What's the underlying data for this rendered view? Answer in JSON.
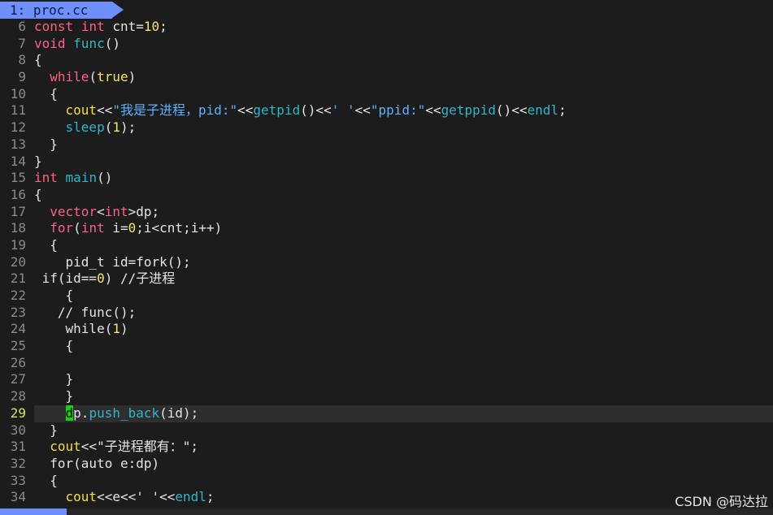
{
  "tabline": {
    "active_tab": "1: proc.cc"
  },
  "colors": {
    "background": "#1c1c1c",
    "tab_active": "#6f8fff",
    "keyword": "#ff5f87",
    "function": "#2fb6c6",
    "number": "#f2e56b",
    "string": "#5fafff",
    "cursor": "#18d018",
    "current_line_number": "#d6e35a"
  },
  "cursor_line": "29",
  "editor": {
    "lines": [
      {
        "num": "6",
        "tokens": [
          [
            "k",
            "const"
          ],
          [
            "d",
            " "
          ],
          [
            "t",
            "int"
          ],
          [
            "d",
            " cnt="
          ],
          [
            "n",
            "10"
          ],
          [
            "d",
            ";"
          ]
        ]
      },
      {
        "num": "7",
        "tokens": [
          [
            "t",
            "void"
          ],
          [
            "d",
            " "
          ],
          [
            "f",
            "func"
          ],
          [
            "d",
            "()"
          ]
        ]
      },
      {
        "num": "8",
        "tokens": [
          [
            "d",
            "{"
          ]
        ]
      },
      {
        "num": "9",
        "tokens": [
          [
            "d",
            "  "
          ],
          [
            "k",
            "while"
          ],
          [
            "d",
            "("
          ],
          [
            "n",
            "true"
          ],
          [
            "d",
            ")"
          ]
        ]
      },
      {
        "num": "10",
        "tokens": [
          [
            "d",
            "  {"
          ]
        ]
      },
      {
        "num": "11",
        "tokens": [
          [
            "d",
            "    "
          ],
          [
            "c",
            "cout"
          ],
          [
            "d",
            "<<"
          ],
          [
            "s",
            "\"我是子进程，pid:\""
          ],
          [
            "d",
            "<<"
          ],
          [
            "f",
            "getpid"
          ],
          [
            "d",
            "()<<"
          ],
          [
            "s",
            "' '"
          ],
          [
            "d",
            "<<"
          ],
          [
            "s",
            "\"ppid:\""
          ],
          [
            "d",
            "<<"
          ],
          [
            "f",
            "getppid"
          ],
          [
            "d",
            "()<<"
          ],
          [
            "f",
            "endl"
          ],
          [
            "d",
            ";"
          ]
        ]
      },
      {
        "num": "12",
        "tokens": [
          [
            "d",
            "    "
          ],
          [
            "f",
            "sleep"
          ],
          [
            "d",
            "("
          ],
          [
            "n",
            "1"
          ],
          [
            "d",
            ");"
          ]
        ]
      },
      {
        "num": "13",
        "tokens": [
          [
            "d",
            "  }"
          ]
        ]
      },
      {
        "num": "14",
        "tokens": [
          [
            "d",
            "}"
          ]
        ]
      },
      {
        "num": "15",
        "tokens": [
          [
            "t",
            "int"
          ],
          [
            "d",
            " "
          ],
          [
            "f",
            "main"
          ],
          [
            "d",
            "()"
          ]
        ]
      },
      {
        "num": "16",
        "tokens": [
          [
            "d",
            "{"
          ]
        ]
      },
      {
        "num": "17",
        "tokens": [
          [
            "d",
            "  "
          ],
          [
            "k",
            "vector"
          ],
          [
            "d",
            "<"
          ],
          [
            "t",
            "int"
          ],
          [
            "d",
            ">dp;"
          ]
        ]
      },
      {
        "num": "18",
        "tokens": [
          [
            "d",
            "  "
          ],
          [
            "k",
            "for"
          ],
          [
            "d",
            "("
          ],
          [
            "t",
            "int"
          ],
          [
            "d",
            " i="
          ],
          [
            "n",
            "0"
          ],
          [
            "d",
            ";i<cnt;i++)"
          ]
        ]
      },
      {
        "num": "19",
        "tokens": [
          [
            "d",
            "  {"
          ]
        ]
      },
      {
        "num": "20",
        "tokens": [
          [
            "d",
            "    pid_t id=fork();"
          ]
        ]
      },
      {
        "num": "21",
        "tokens": [
          [
            "d",
            " if(id=="
          ],
          [
            "n",
            "0"
          ],
          [
            "d",
            ") //子进程"
          ]
        ]
      },
      {
        "num": "22",
        "tokens": [
          [
            "d",
            "    {"
          ]
        ]
      },
      {
        "num": "23",
        "tokens": [
          [
            "d",
            "   // func();"
          ]
        ]
      },
      {
        "num": "24",
        "tokens": [
          [
            "d",
            "    while("
          ],
          [
            "n",
            "1"
          ],
          [
            "d",
            ")"
          ]
        ]
      },
      {
        "num": "25",
        "tokens": [
          [
            "d",
            "    {"
          ]
        ]
      },
      {
        "num": "26",
        "tokens": []
      },
      {
        "num": "27",
        "tokens": [
          [
            "d",
            "    }"
          ]
        ]
      },
      {
        "num": "28",
        "tokens": [
          [
            "d",
            "    }"
          ]
        ]
      },
      {
        "num": "29",
        "tokens": [
          [
            "d",
            "    "
          ],
          [
            "cur",
            "d"
          ],
          [
            "d",
            "p."
          ],
          [
            "f",
            "push_back"
          ],
          [
            "d",
            "(id);"
          ]
        ]
      },
      {
        "num": "30",
        "tokens": [
          [
            "d",
            "  }"
          ]
        ]
      },
      {
        "num": "31",
        "tokens": [
          [
            "d",
            "  "
          ],
          [
            "c",
            "cout"
          ],
          [
            "d",
            "<<\"子进程都有：\";"
          ]
        ]
      },
      {
        "num": "32",
        "tokens": [
          [
            "d",
            "  for(auto e:dp)"
          ]
        ]
      },
      {
        "num": "33",
        "tokens": [
          [
            "d",
            "  {"
          ]
        ]
      },
      {
        "num": "34",
        "tokens": [
          [
            "d",
            "    "
          ],
          [
            "c",
            "cout"
          ],
          [
            "d",
            "<<e<<' '<<"
          ],
          [
            "f",
            "endl"
          ],
          [
            "d",
            ";"
          ]
        ]
      }
    ]
  },
  "watermark": "CSDN @码达拉"
}
